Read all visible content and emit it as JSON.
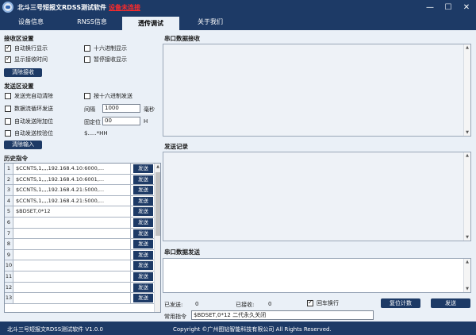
{
  "app": {
    "title": "北斗三号短报文RDSS测试软件",
    "connection_status": "设备未连接",
    "window_controls": {
      "minimize": "—",
      "maximize": "☐",
      "close": "✕"
    }
  },
  "tabs": [
    {
      "label": "设备信息"
    },
    {
      "label": "RNSS信息"
    },
    {
      "label": "透传调试"
    },
    {
      "label": "关于我们"
    }
  ],
  "receive_settings": {
    "title": "接收区设置",
    "auto_newline": {
      "label": "自动换行显示",
      "checked": true
    },
    "hex_display": {
      "label": "十六进制显示",
      "checked": false
    },
    "show_receive_time": {
      "label": "显示接收时间",
      "checked": true
    },
    "pause_receive": {
      "label": "暂停接收显示",
      "checked": false
    },
    "clear_button": "清除接收"
  },
  "send_settings": {
    "title": "发送区设置",
    "auto_clear": {
      "label": "发送完自动清除",
      "checked": false
    },
    "hex_send": {
      "label": "按十六进制发送",
      "checked": false
    },
    "loop_send": {
      "label": "数据流循环发送",
      "checked": false
    },
    "interval_label": "间隔",
    "interval_value": "1000",
    "interval_unit": "毫秒",
    "auto_append": {
      "label": "自动发送附加位",
      "checked": false
    },
    "fixed_label": "固定位",
    "fixed_value": "00",
    "fixed_unit": "H",
    "auto_checksum": {
      "label": "自动发送校验位",
      "checked": false
    },
    "checksum_hint": "$.....*HH",
    "clear_button": "清除输入"
  },
  "history": {
    "title": "历史指令",
    "send_label": "发送",
    "rows": [
      {
        "num": "1",
        "cmd": "$CCNTS,1,,,,192.168.4.10:6000,..."
      },
      {
        "num": "2",
        "cmd": "$CCNTS,1,,,,192.168.4.10:6001,..."
      },
      {
        "num": "3",
        "cmd": "$CCNTS,1,,,,192.168.4.21:5000,..."
      },
      {
        "num": "4",
        "cmd": "$CCNTS,1,,,,192.168.4.21:5000,..."
      },
      {
        "num": "5",
        "cmd": "$BDSET,0*12"
      },
      {
        "num": "6",
        "cmd": ""
      },
      {
        "num": "7",
        "cmd": ""
      },
      {
        "num": "8",
        "cmd": ""
      },
      {
        "num": "9",
        "cmd": ""
      },
      {
        "num": "10",
        "cmd": ""
      },
      {
        "num": "11",
        "cmd": ""
      },
      {
        "num": "12",
        "cmd": ""
      },
      {
        "num": "13",
        "cmd": ""
      }
    ]
  },
  "serial_receive": {
    "title": "串口数据接收"
  },
  "send_log": {
    "title": "发送记录"
  },
  "serial_send": {
    "title": "串口数据发送"
  },
  "counters": {
    "sent_label": "已发送:",
    "sent_value": "0",
    "received_label": "已接收:",
    "received_value": "0",
    "crlf": {
      "label": "回车换行",
      "checked": true
    },
    "reset_button": "复位计数"
  },
  "common_cmd": {
    "label": "常用指令",
    "value": "$BDSET,0*12 二代永久关闭",
    "send_button": "发送"
  },
  "footer": {
    "version": "北斗三号短报文RDSS测试软件 V1.0.0",
    "copyright": "Copyright ©广州图钻智能科技有限公司  All Rights Reserved."
  }
}
